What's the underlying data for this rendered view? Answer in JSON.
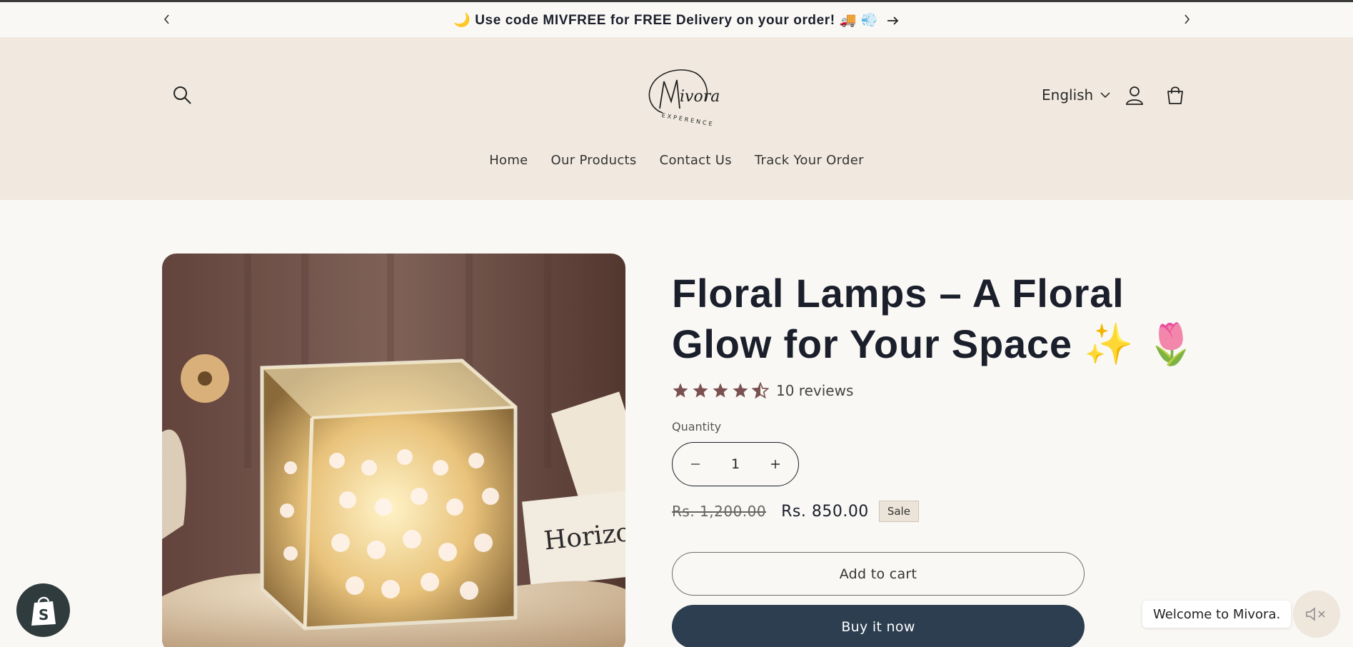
{
  "announcement": {
    "message": "🌙 Use code MIVFREE for FREE Delivery on your order! 🚚 💨",
    "prev_icon": "chevron-left-icon",
    "next_icon": "chevron-right-icon"
  },
  "header": {
    "logo_text": "Mivora",
    "logo_subtext": "EXPERENCE",
    "language": "English",
    "nav": [
      {
        "label": "Home"
      },
      {
        "label": "Our Products"
      },
      {
        "label": "Contact Us"
      },
      {
        "label": "Track Your Order"
      }
    ]
  },
  "product": {
    "title": "Floral Lamps – A Floral Glow for Your Space ✨ 🌷",
    "rating": 4.5,
    "rating_max": 5,
    "reviews_label": "10 reviews",
    "quantity_label": "Quantity",
    "quantity": "1",
    "old_price": "Rs. 1,200.00",
    "price": "Rs. 850.00",
    "sale_label": "Sale",
    "add_to_cart": "Add to cart",
    "buy_now": "Buy it now"
  },
  "widgets": {
    "welcome_message": "Welcome to Mivora."
  },
  "colors": {
    "header_bg": "#f1e9df",
    "page_bg": "#f9f8f5",
    "star": "#7a5050",
    "buy_button": "#2c3e50"
  }
}
